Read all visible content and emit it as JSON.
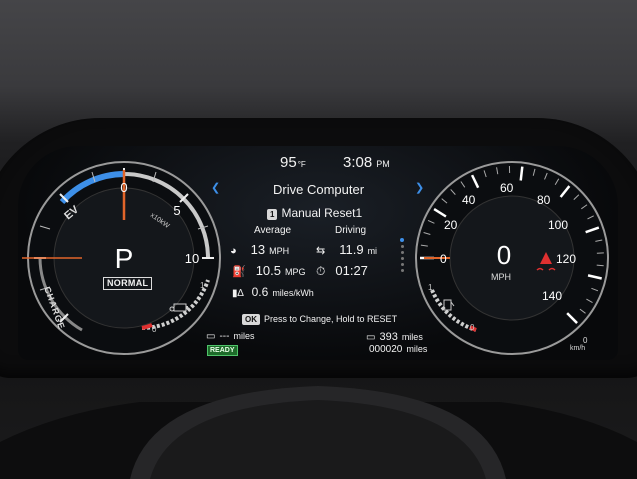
{
  "status": {
    "temperature": "95",
    "temp_unit": "°F",
    "time": "3:08",
    "time_suffix": "PM"
  },
  "drive_computer": {
    "title": "Drive Computer",
    "reset_index": "1",
    "reset_label": "Manual Reset1",
    "col_average": "Average",
    "col_driving": "Driving",
    "avg_speed": "13",
    "avg_speed_unit": "MPH",
    "driving_distance": "11.9",
    "driving_distance_unit": "mi",
    "fuel_economy": "10.5",
    "fuel_economy_unit": "MPG",
    "driving_time": "01:27",
    "electric_economy": "0.6",
    "electric_economy_unit": "miles/kWh",
    "ok_chip": "OK",
    "hint": "Press to Change, Hold to RESET"
  },
  "power_meter": {
    "gear": "P",
    "mode": "NORMAL",
    "label_ev": "EV",
    "label_charge": "CHARGE",
    "label_scale": "x10kW",
    "ticks": [
      "0",
      "5",
      "10"
    ],
    "battery_ticks": [
      "0",
      "1"
    ],
    "needle_value_kw": 0
  },
  "speedometer": {
    "speed": "0",
    "unit": "MPH",
    "ticks": [
      "0",
      "20",
      "40",
      "60",
      "80",
      "100",
      "120",
      "140"
    ],
    "fuel_ticks": [
      "0",
      "1"
    ],
    "kmh_value": "0",
    "kmh_unit": "km/h"
  },
  "bottom": {
    "ev_range": "---",
    "ev_range_unit": "miles",
    "ready": "READY",
    "fuel_range": "393",
    "fuel_range_unit": "miles",
    "odometer": "000020",
    "odometer_unit": "miles"
  },
  "colors": {
    "accent_blue": "#3d8fe8",
    "needle_orange": "#e2652a",
    "warning_red": "#e03030",
    "ready_green": "#1d6b2a"
  }
}
